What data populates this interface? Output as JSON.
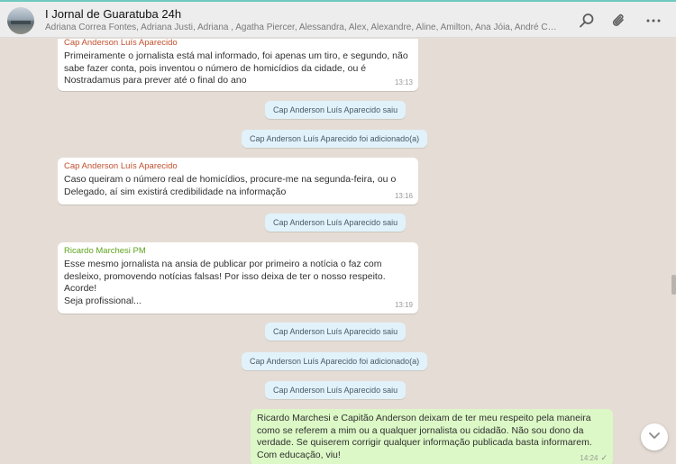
{
  "header": {
    "title": "I Jornal de Guaratuba 24h",
    "members": "Adriana Correa Fontes, Adriana Justi, Adriana , Agatha Piercer, Alessandra, Alex, Alexandre, Aline, Amilton, Ana Jóia, André CPD Prefeitura"
  },
  "icons": {
    "search": "search-icon",
    "attach": "paperclip-icon",
    "menu": "more-vertical-icon",
    "scroll": "chevron-down-icon"
  },
  "colors": {
    "sender_red": "#c1502e",
    "sender_green": "#5ea41d",
    "outgoing_bubble": "#dcf8c6",
    "system_notice": "#e1f2fb"
  },
  "messages": {
    "m1": {
      "sender": "Cap Anderson Luís Aparecido",
      "text": "Primeiramente o jornalista está mal informado, foi apenas um tiro, e segundo, não\nsabe fazer conta, pois inventou o número de homicídios da cidade, ou é\nNostradamus para prever até o final do ano",
      "time": "13:13"
    },
    "s1": "Cap Anderson Luís Aparecido saiu",
    "s2": "Cap Anderson Luís Aparecido foi adicionado(a)",
    "m2": {
      "sender": "Cap Anderson Luís Aparecido",
      "text": "Caso queiram o número real de homicídios, procure-me na segunda-feira, ou o\nDelegado, aí sim existirá credibilidade na informação",
      "time": "13:16"
    },
    "s3": "Cap Anderson Luís Aparecido saiu",
    "m3": {
      "sender": "Ricardo Marchesi PM",
      "text": "Esse mesmo jornalista na ansia de publicar por primeiro a notícia o faz com\ndesleixo, promovendo notícias falsas! Por isso deixa de ter o nosso respeito.\nAcorde!\nSeja profissional...",
      "time": "13:19"
    },
    "s4": "Cap Anderson Luís Aparecido saiu",
    "s5": "Cap Anderson Luís Aparecido foi adicionado(a)",
    "s6": "Cap Anderson Luís Aparecido saiu",
    "m4": {
      "text": "Ricardo Marchesi e Capitão Anderson deixam de ter meu respeito pela maneira\ncomo se referem a mim ou a qualquer jornalista ou cidadão. Não sou dono da\nverdade. Se quiserem corrigir qualquer informação publicada basta informarem.\nCom educação, viu!",
      "time": "14:24",
      "ticks": "✓"
    }
  }
}
